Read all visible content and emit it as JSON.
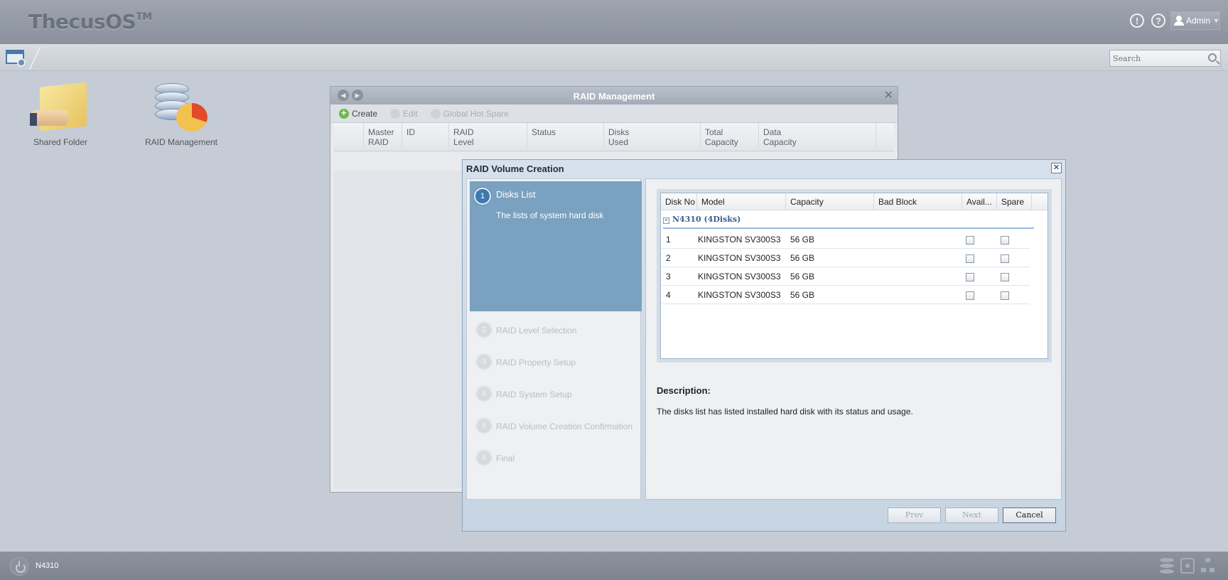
{
  "app": {
    "title": "ThecusOS",
    "trademark": "TM"
  },
  "header": {
    "user_label": "Admin",
    "search_placeholder": "Search"
  },
  "desktop": {
    "icons": [
      {
        "label": "Shared Folder"
      },
      {
        "label": "RAID Management"
      }
    ]
  },
  "raid_window": {
    "title": "RAID Management",
    "toolbar": {
      "create": "Create",
      "edit": "Edit",
      "global_hot_spare": "Global Hot Spare"
    },
    "columns": [
      {
        "l1": "Master",
        "l2": "RAID"
      },
      {
        "l1": "ID",
        "l2": ""
      },
      {
        "l1": "RAID",
        "l2": "Level"
      },
      {
        "l1": "Status",
        "l2": ""
      },
      {
        "l1": "Disks",
        "l2": "Used"
      },
      {
        "l1": "Total",
        "l2": "Capacity"
      },
      {
        "l1": "Data",
        "l2": "Capacity"
      }
    ]
  },
  "dialog": {
    "title": "RAID Volume Creation",
    "steps": [
      {
        "num": "1",
        "title": "Disks List",
        "desc": "The lists of system hard disk"
      },
      {
        "num": "2",
        "title": "RAID Level Selection"
      },
      {
        "num": "3",
        "title": "RAID Property Setup"
      },
      {
        "num": "4",
        "title": "RAID System Setup"
      },
      {
        "num": "5",
        "title": "RAID Volume Creation Confirmation"
      },
      {
        "num": "6",
        "title": "Final"
      }
    ],
    "grid": {
      "columns": {
        "disk_no": "Disk No",
        "model": "Model",
        "capacity": "Capacity",
        "bad_block": "Bad Block",
        "available": "Avail...",
        "spare": "Spare"
      },
      "group_label": "N4310 (4Disks)",
      "rows": [
        {
          "disk_no": "1",
          "model": "KINGSTON SV300S3",
          "capacity": "56 GB",
          "bad_block": ""
        },
        {
          "disk_no": "2",
          "model": "KINGSTON SV300S3",
          "capacity": "56 GB",
          "bad_block": ""
        },
        {
          "disk_no": "3",
          "model": "KINGSTON SV300S3",
          "capacity": "56 GB",
          "bad_block": ""
        },
        {
          "disk_no": "4",
          "model": "KINGSTON SV300S3",
          "capacity": "56 GB",
          "bad_block": ""
        }
      ]
    },
    "description_title": "Description:",
    "description_text": "The disks list has listed installed hard disk with its status and usage.",
    "buttons": {
      "prev": "Prev",
      "next": "Next",
      "cancel": "Cancel"
    }
  },
  "footer": {
    "model": "N4310"
  }
}
